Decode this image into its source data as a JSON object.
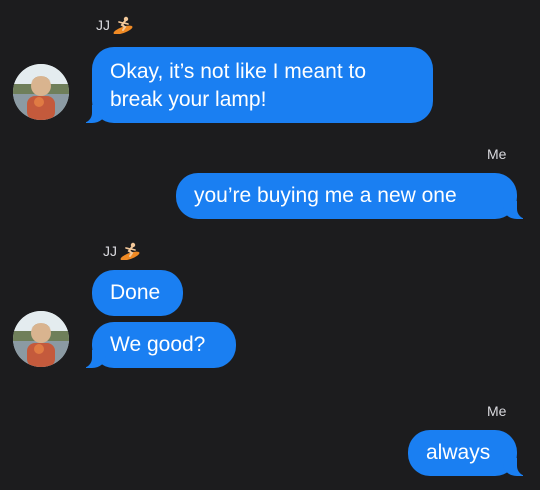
{
  "conversation": {
    "messages": [
      {
        "sender": "JJ",
        "text": "Okay, it’s not like I meant to\nbreak your lamp!"
      },
      {
        "sender": "Me",
        "text": "you’re buying me a new one"
      },
      {
        "sender": "JJ",
        "text": "Done"
      },
      {
        "sender": "JJ",
        "text": "We good?"
      },
      {
        "sender": "Me",
        "text": "always"
      }
    ],
    "labels": {
      "jj_1": "JJ",
      "me_1": "Me",
      "jj_2": "JJ",
      "me_2": "Me"
    }
  },
  "colors": {
    "background": "#1c1c1e",
    "bubble": "#1a7ff2",
    "label": "#d9d9de"
  },
  "icons": {
    "sender_emoji": "surfer-icon",
    "avatar": "contact-photo"
  }
}
